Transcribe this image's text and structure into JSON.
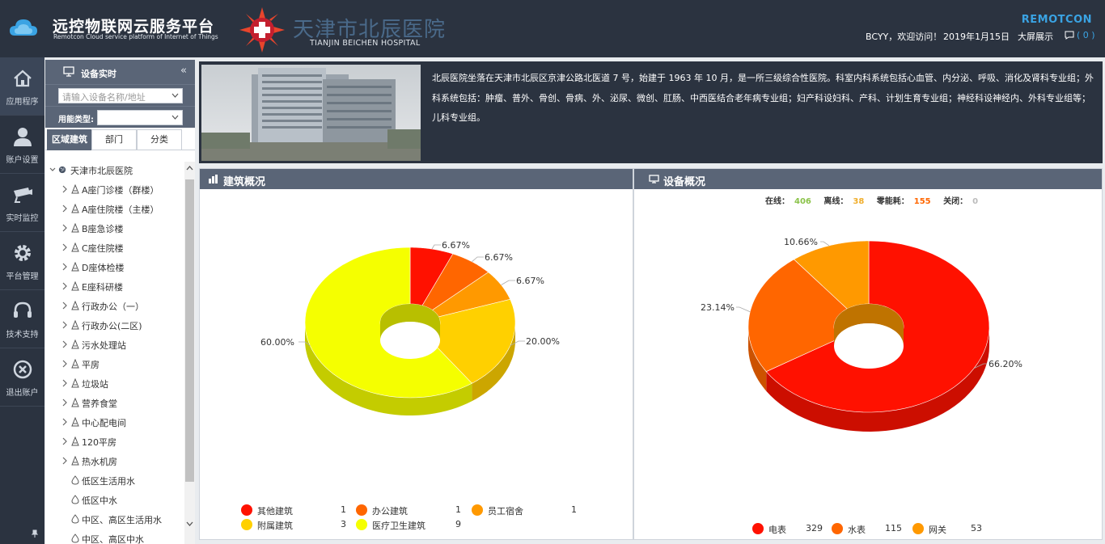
{
  "header": {
    "brand_title": "远控物联网云服务平台",
    "brand_subtitle": "Remotcon Cloud service platform of Internet of Things",
    "hospital_name": "天津市北辰医院",
    "hospital_en": "TIANJIN BEICHEN HOSPITAL",
    "welcome": "BCYY，欢迎访问！",
    "date": "2019年1月15日",
    "big_screen": "大屏展示",
    "messages": "( 0 )",
    "remotcon": "REMOTCON"
  },
  "nav": {
    "items": [
      {
        "label": "应用程序",
        "icon": "home-icon"
      },
      {
        "label": "账户设置",
        "icon": "user-icon"
      },
      {
        "label": "实时监控",
        "icon": "camera-icon"
      },
      {
        "label": "平台管理",
        "icon": "gear-icon"
      },
      {
        "label": "技术支持",
        "icon": "headset-icon"
      },
      {
        "label": "退出账户",
        "icon": "close-circle-icon"
      }
    ]
  },
  "tree_panel": {
    "title": "设备实时",
    "search_placeholder": "请输入设备名称/地址",
    "energy_type_label": "用能类型:",
    "tabs": [
      "区域建筑",
      "部门",
      "分类"
    ],
    "root": "天津市北辰医院",
    "items": [
      {
        "label": "A座门诊楼（群楼）",
        "type": "building"
      },
      {
        "label": "A座住院楼（主楼）",
        "type": "building"
      },
      {
        "label": "B座急诊楼",
        "type": "building"
      },
      {
        "label": "C座住院楼",
        "type": "building"
      },
      {
        "label": "D座体检楼",
        "type": "building"
      },
      {
        "label": "E座科研楼",
        "type": "building"
      },
      {
        "label": "行政办公（一）",
        "type": "building"
      },
      {
        "label": "行政办公(二区)",
        "type": "building"
      },
      {
        "label": "污水处理站",
        "type": "building"
      },
      {
        "label": "平房",
        "type": "building"
      },
      {
        "label": "垃圾站",
        "type": "building"
      },
      {
        "label": "营养食堂",
        "type": "building"
      },
      {
        "label": "中心配电间",
        "type": "building"
      },
      {
        "label": "120平房",
        "type": "building"
      },
      {
        "label": "热水机房",
        "type": "building"
      },
      {
        "label": "低区生活用水",
        "type": "water"
      },
      {
        "label": "低区中水",
        "type": "water"
      },
      {
        "label": "中区、高区生活用水",
        "type": "water"
      },
      {
        "label": "中区、高区中水",
        "type": "water"
      }
    ]
  },
  "info": {
    "description": "北辰医院坐落在天津市北辰区京津公路北医道 7 号，始建于 1963 年 10 月，是一所三级综合性医院。科室内科系统包括心血管、内分泌、呼吸、消化及肾科专业组；外科系统包括：肿瘤、普外、骨创、骨病、外、泌尿、微创、肛肠、中西医结合老年病专业组；妇产科设妇科、产科、计划生育专业组；神经科设神经内、外科专业组等；儿科专业组。"
  },
  "building_panel": {
    "title": "建筑概况",
    "legend": [
      {
        "name": "其他建筑",
        "value": "1",
        "color": "#ff1100"
      },
      {
        "name": "办公建筑",
        "value": "1",
        "color": "#ff6600"
      },
      {
        "name": "员工宿舍",
        "value": "1",
        "color": "#ff9900"
      },
      {
        "name": "附属建筑",
        "value": "3",
        "color": "#ffd000"
      },
      {
        "name": "医疗卫生建筑",
        "value": "9",
        "color": "#f5ff00"
      }
    ]
  },
  "device_panel": {
    "title": "设备概况",
    "stats": {
      "online_label": "在线：",
      "online": "406",
      "offline_label": "离线：",
      "offline": "38",
      "zero_label": "零能耗：",
      "zero": "155",
      "closed_label": "关闭：",
      "closed": "0"
    },
    "legend": [
      {
        "name": "电表",
        "value": "329",
        "color": "#ff1100"
      },
      {
        "name": "水表",
        "value": "115",
        "color": "#ff6600"
      },
      {
        "name": "网关",
        "value": "53",
        "color": "#ff9900"
      }
    ]
  },
  "chart_data": [
    {
      "type": "pie",
      "categories": [
        "其他建筑",
        "办公建筑",
        "员工宿舍",
        "附属建筑",
        "医疗卫生建筑"
      ],
      "values": [
        1,
        1,
        1,
        3,
        9
      ],
      "labels": [
        "6.67%",
        "6.67%",
        "6.67%",
        "20.00%",
        "60.00%"
      ],
      "colors": [
        "#ff1100",
        "#ff6600",
        "#ff9900",
        "#ffd000",
        "#f5ff00"
      ],
      "donut": true,
      "legend": "bottom"
    },
    {
      "type": "pie",
      "categories": [
        "电表",
        "水表",
        "网关"
      ],
      "values": [
        329,
        115,
        53
      ],
      "labels": [
        "66.20%",
        "23.14%",
        "10.66%"
      ],
      "colors": [
        "#ff1100",
        "#ff6600",
        "#ff9900"
      ],
      "donut": true,
      "legend": "bottom"
    }
  ]
}
